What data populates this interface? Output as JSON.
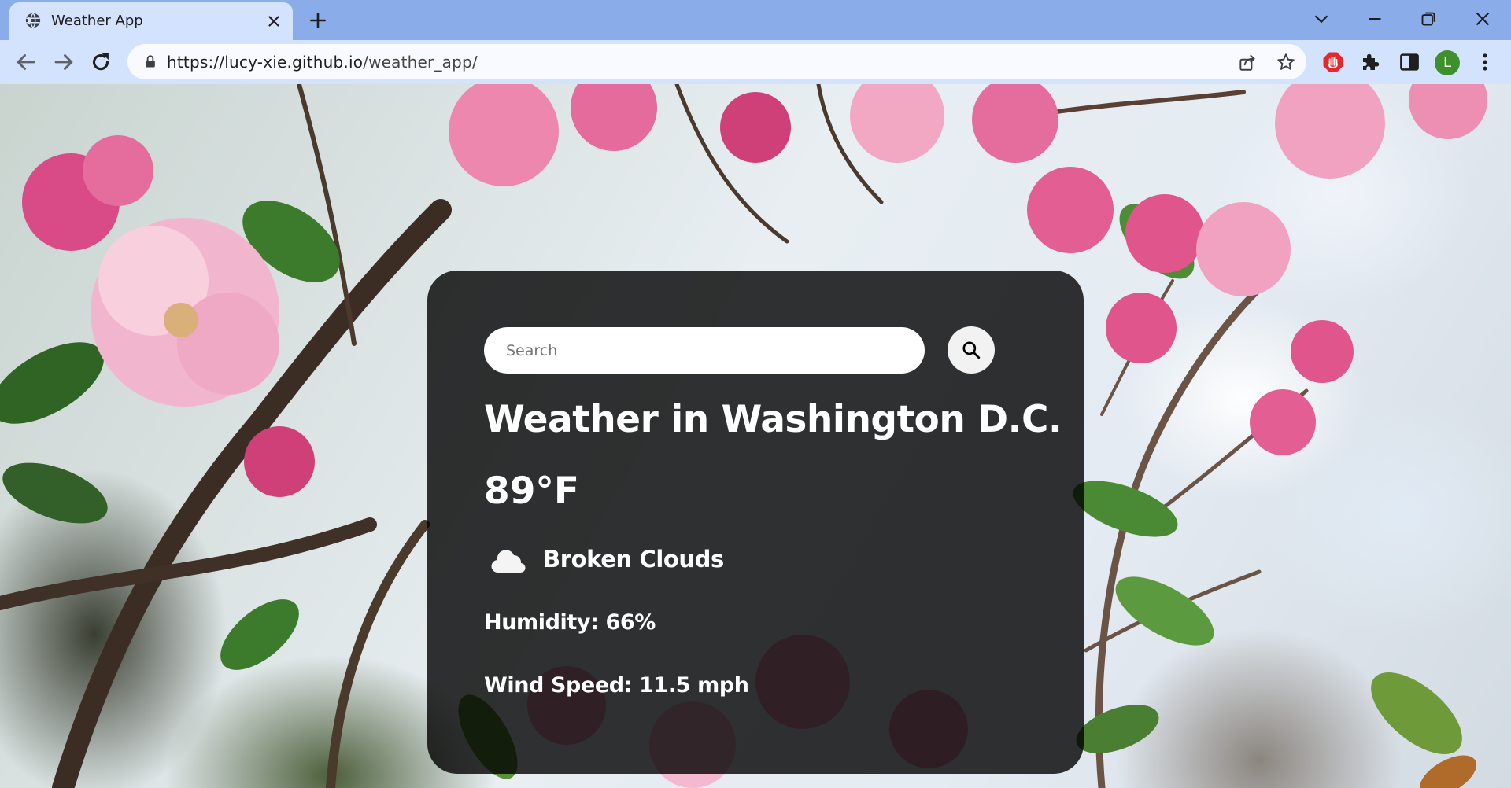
{
  "browser": {
    "tab_title": "Weather App",
    "url_host": "https://lucy-xie.github.io",
    "url_path": "/weather_app/",
    "profile_initial": "L",
    "icons": [
      "globe-icon",
      "close-icon",
      "plus-icon",
      "chevron-down-icon",
      "minimize-icon",
      "restore-icon",
      "window-close-icon",
      "back-arrow-icon",
      "forward-arrow-icon",
      "reload-icon",
      "lock-icon",
      "share-icon",
      "star-icon",
      "adblock-icon",
      "puzzle-icon",
      "sidepanel-icon",
      "kebab-menu-icon"
    ],
    "colors": {
      "tabstrip": "#8aadea",
      "toolbar": "#d3e3fd",
      "avatar": "#3f8f2c"
    }
  },
  "weather": {
    "search_placeholder": "Search",
    "city": "Weather in Washington D.C.",
    "temperature": "89°F",
    "condition": "Broken Clouds",
    "condition_icon": "cloud-icon",
    "humidity": "Humidity: 66%",
    "wind": "Wind Speed: 11.5 mph"
  }
}
